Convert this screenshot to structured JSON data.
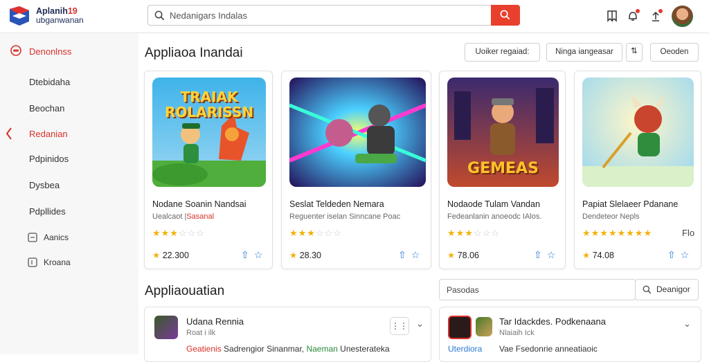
{
  "header": {
    "brand_line1_main": "Aplanih",
    "brand_line1_accent": "19",
    "brand_line2": "ubganwanan",
    "search_placeholder": "Nedanigars Indalas",
    "icons": [
      "search-icon",
      "bookmark-icon",
      "bell-icon",
      "share-icon",
      "avatar"
    ]
  },
  "sidebar": {
    "items": [
      {
        "label": "Denonlnss",
        "active": true
      },
      {
        "label": "Dtebidaha"
      },
      {
        "label": "Beochan"
      },
      {
        "label": "Redanian",
        "selected": true
      },
      {
        "label": "Pdpinidos"
      },
      {
        "label": "Dysbea"
      },
      {
        "label": "Pdpllides"
      },
      {
        "label": "Aanics"
      },
      {
        "label": "Kroana"
      }
    ]
  },
  "main": {
    "section1_title": "Appliaoa Inandai",
    "filters": [
      "Uoiker regaiad:",
      "Ninga iangeasar",
      "Oeoden"
    ],
    "cards": [
      {
        "title": "Nodane Soanin Nandsai",
        "sub_plain": "Uealcaot |",
        "sub_accent": "Sasanal",
        "stars_full": 3,
        "score": "22.300",
        "art_text": "TRAIAK ROLARISSN"
      },
      {
        "title": "Seslat Teldeden Nemara",
        "sub_plain": "Reguenter iselan Sinncane Poac",
        "stars_full": 3,
        "score": "28.30"
      },
      {
        "title": "Nodaode Tulam Vandan",
        "sub_plain": "Fedeanlanin anoeodc IAlos.",
        "stars_full": 3,
        "score": "78.06",
        "art_text": "GEMEAS"
      },
      {
        "title": "Papiat Slelaeer Pdanane",
        "sub_plain": "Dendeteor Nepls",
        "stars_full": 8,
        "score": "74.08",
        "extra": "Flo"
      }
    ],
    "section2_title": "Appliaouatian",
    "search2_placeholder": "Pasodas",
    "search2_button": "Deanigor",
    "list": [
      {
        "title": "Udana Rennia",
        "sub": "Roat i ilk",
        "line_red": "Geatienis",
        "line_mid": "Sadrengior Sinanmar,",
        "line_green": "Naeman",
        "line_end": "Unesterateka"
      },
      {
        "title": "Tar Idackdes. Podkenaana",
        "sub": "Nlaiaih Ick",
        "line_blue": "Uterdiora",
        "line_end": "Vae Fsedonrie anneatiaoic"
      }
    ]
  }
}
